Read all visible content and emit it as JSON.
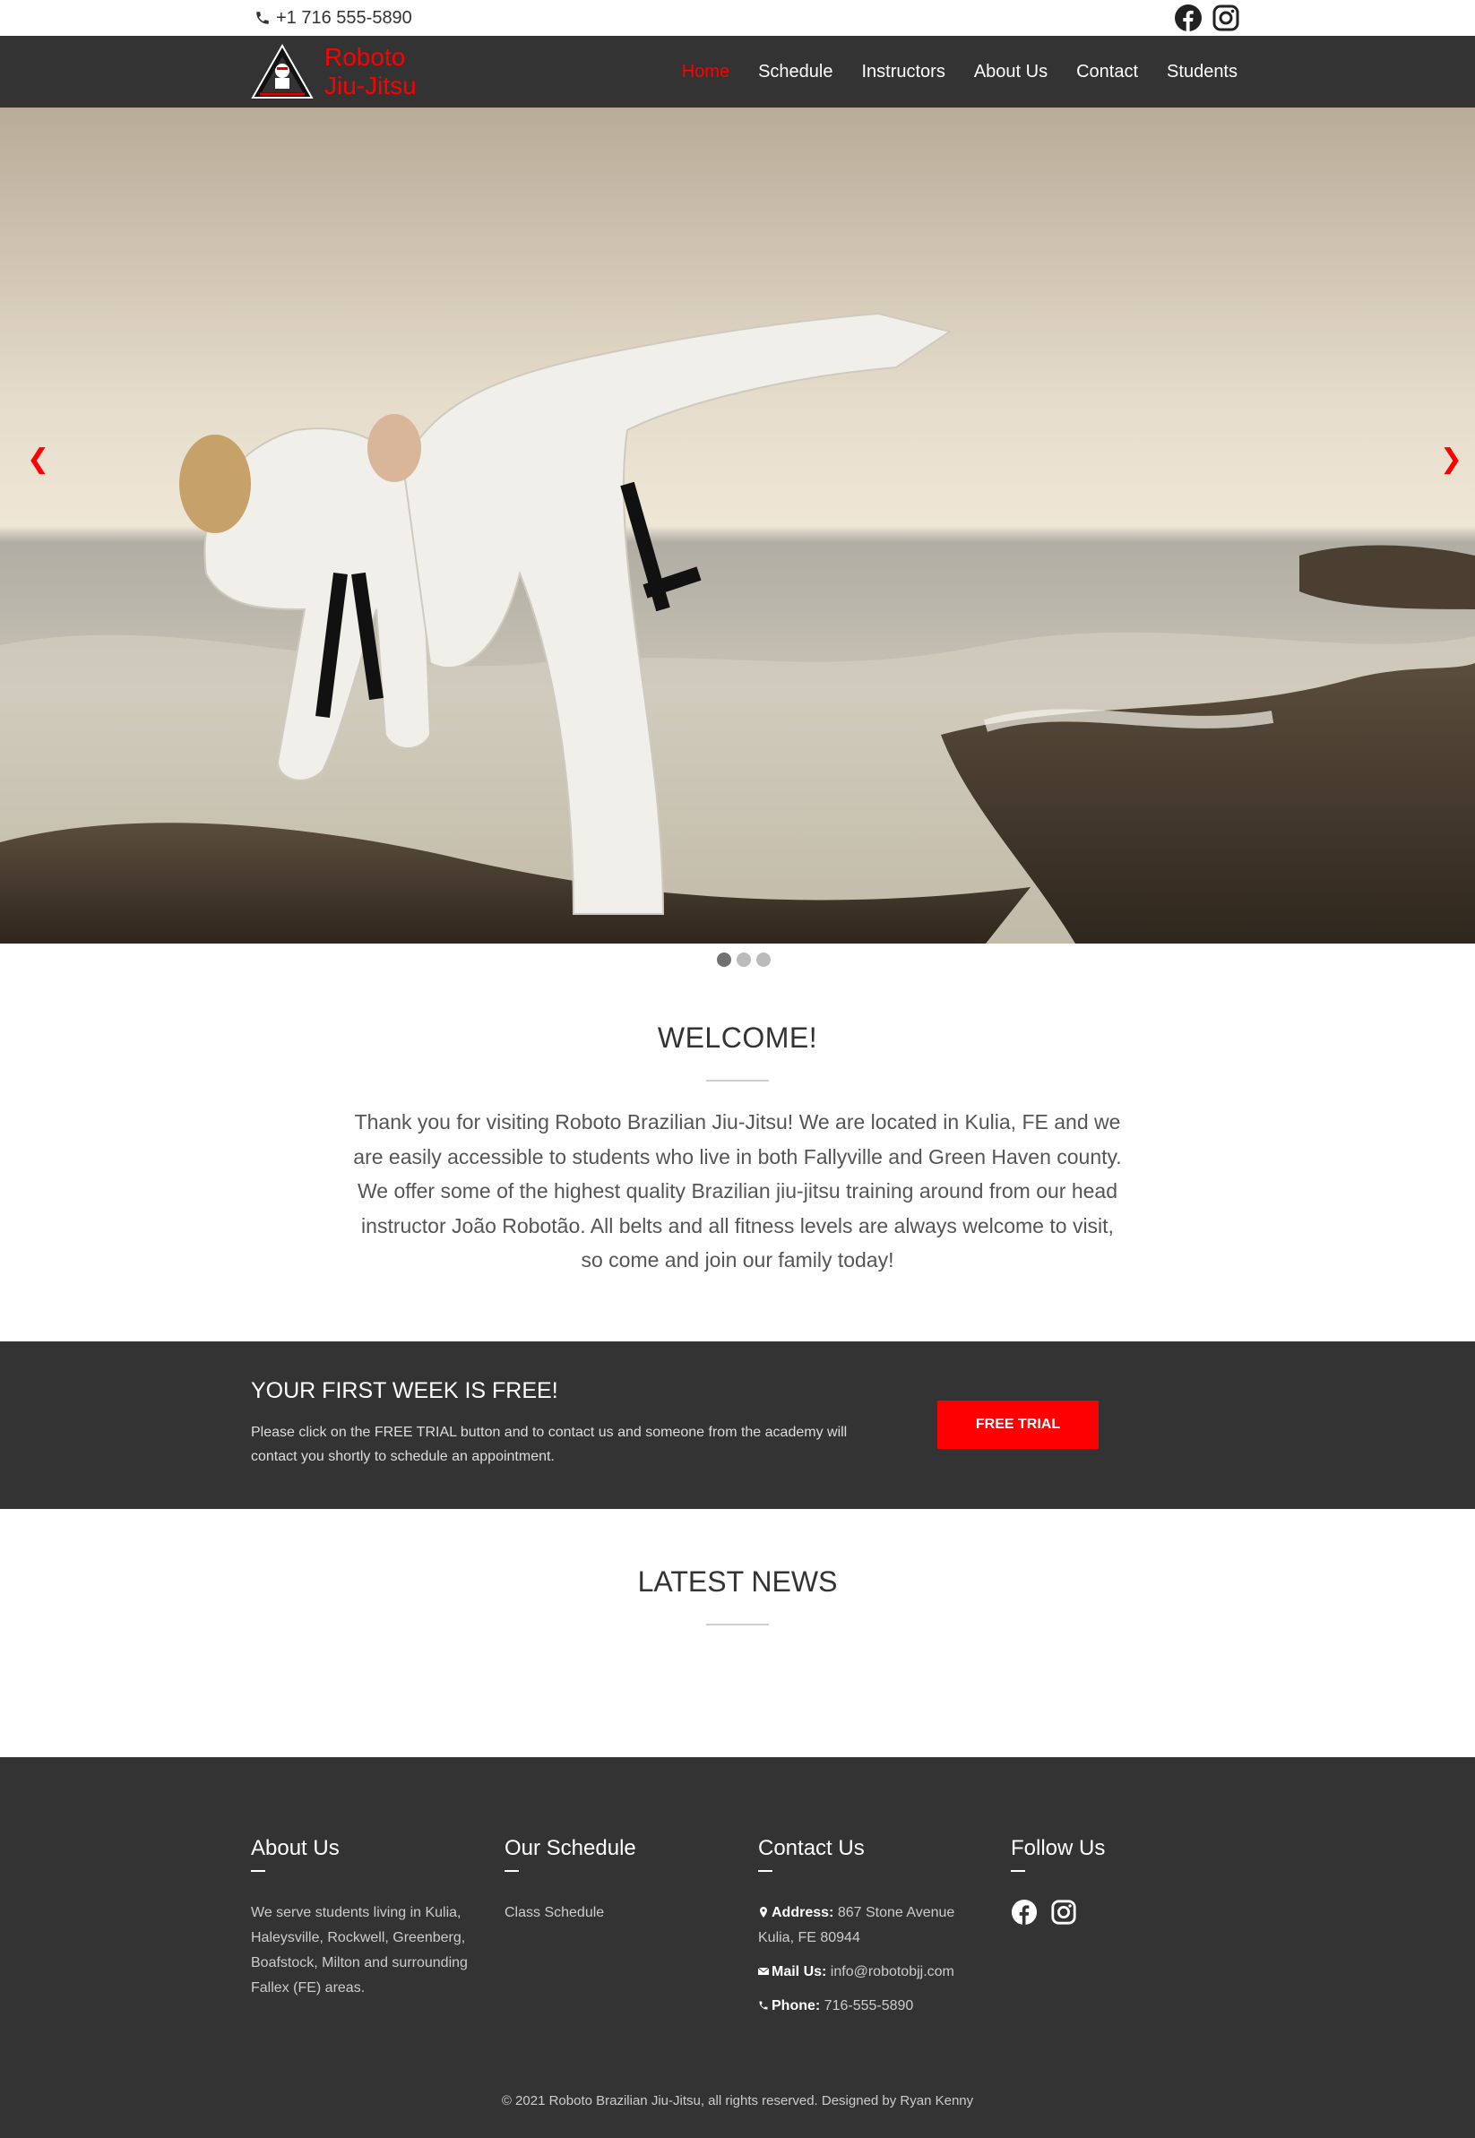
{
  "topbar": {
    "phone": "+1 716 555-5890",
    "social": [
      {
        "icon": "facebook-icon"
      },
      {
        "icon": "instagram-icon"
      }
    ]
  },
  "brand": {
    "line1": "Roboto",
    "line2": "Jiu-Jitsu",
    "accent_color": "#ff0000"
  },
  "nav": {
    "items": [
      {
        "label": "Home",
        "active": true
      },
      {
        "label": "Schedule"
      },
      {
        "label": "Instructors"
      },
      {
        "label": "About Us"
      },
      {
        "label": "Contact"
      },
      {
        "label": "Students"
      }
    ]
  },
  "hero": {
    "prev_arrow": "❮",
    "next_arrow": "❯",
    "slide_count": 3,
    "active_slide": 1
  },
  "welcome": {
    "title": "WELCOME!",
    "body": "Thank you for visiting Roboto Brazilian Jiu-Jitsu! We are located in Kulia, FE and we are easily accessible to students who live in both Fallyville and Green Haven county. We offer some of the highest quality Brazilian jiu-jitsu training around from our head instructor João Robotão. All belts and all fitness levels are always welcome to visit, so come and join our family today!"
  },
  "trial": {
    "title": "YOUR FIRST WEEK IS FREE!",
    "body": "Please click on the FREE TRIAL button and to contact us and someone from the academy will contact you shortly to schedule an appointment.",
    "button": "FREE TRIAL"
  },
  "news": {
    "title": "LATEST NEWS"
  },
  "footer": {
    "about": {
      "title": "About Us",
      "text": "We serve students living in Kulia, Haleysville, Rockwell, Greenberg, Boafstock, Milton and surrounding Fallex (FE) areas."
    },
    "schedule": {
      "title": "Our Schedule",
      "link": "Class Schedule"
    },
    "contact": {
      "title": "Contact Us",
      "address_label": "Address:",
      "address_line1": "867 Stone Avenue",
      "address_line2": "Kulia, FE 80944",
      "mail_label": "Mail Us:",
      "mail": "info@robotobjj.com",
      "phone_label": "Phone:",
      "phone": "716-555-5890"
    },
    "follow": {
      "title": "Follow Us"
    },
    "copyright": "© 2021 Roboto Brazilian Jiu-Jitsu, all rights reserved. Designed by Ryan Kenny"
  }
}
